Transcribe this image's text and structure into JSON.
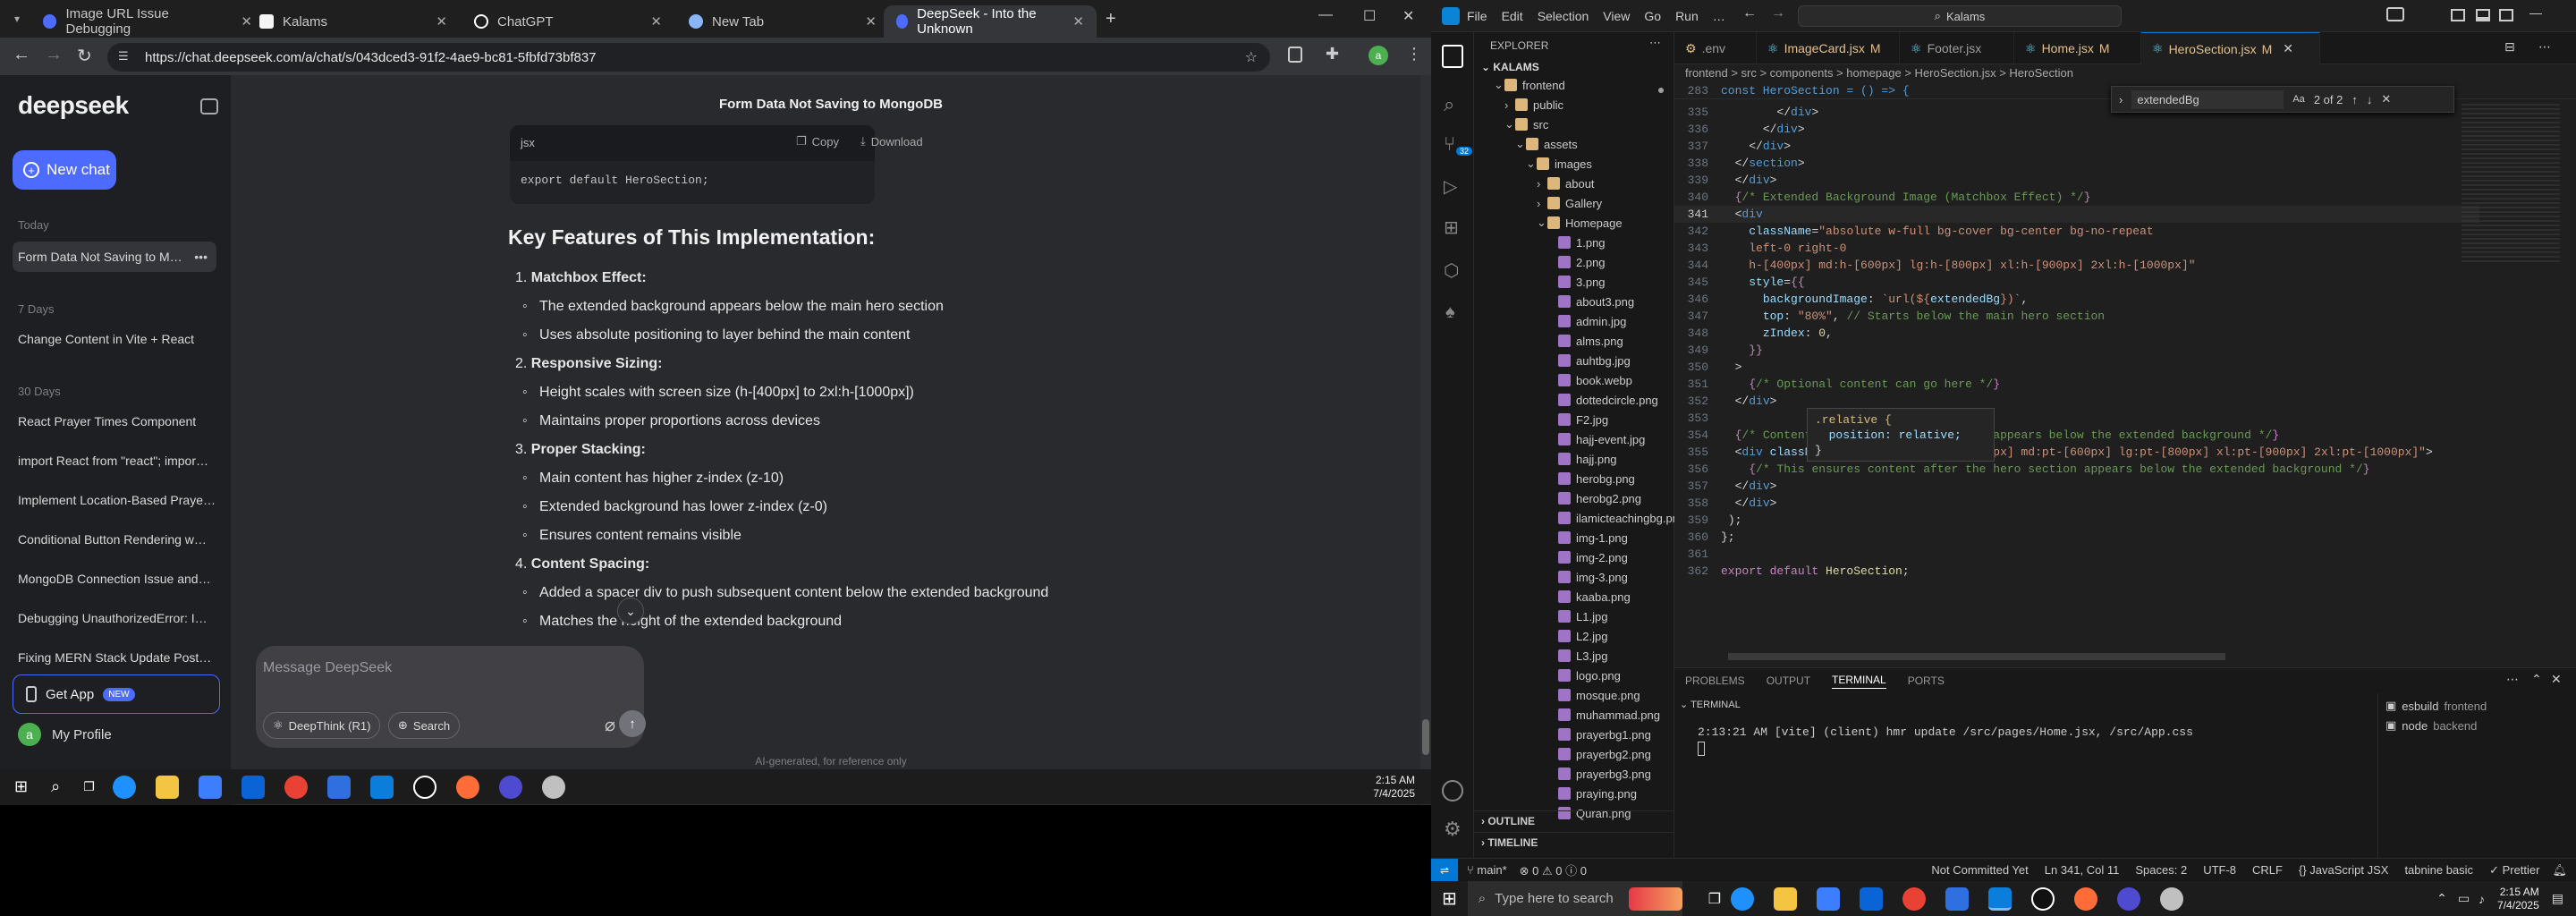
{
  "chrome": {
    "tabs": [
      {
        "title": "Image URL Issue Debugging",
        "favicon_color": "#4d6bfe"
      },
      {
        "title": "Kalams",
        "favicon_color": "#f5f5f5"
      },
      {
        "title": "ChatGPT",
        "favicon_color": "#ffffff"
      },
      {
        "title": "New Tab",
        "favicon_color": "#8ab4f8"
      },
      {
        "title": "DeepSeek - Into the Unknown",
        "favicon_color": "#4d6bfe"
      }
    ],
    "url": "https://chat.deepseek.com/a/chat/s/043dced3-91f2-4ae9-bc81-5fbfd73bf837"
  },
  "deepseek": {
    "logo": "deepseek",
    "new_chat": "New chat",
    "sections": [
      {
        "label": "Today",
        "items": [
          "Form Data Not Saving to M…"
        ]
      },
      {
        "label": "7 Days",
        "items": [
          "Change Content in Vite + React"
        ]
      },
      {
        "label": "30 Days",
        "items": [
          "React Prayer Times Component",
          "import React from \"react\"; impor…",
          "Implement Location-Based Praye…",
          "Conditional Button Rendering w…",
          "MongoDB Connection Issue and…",
          "Debugging UnauthorizedError: I…",
          "Fixing MERN Stack Update Post…"
        ]
      }
    ],
    "get_app": "Get App",
    "new_badge": "NEW",
    "profile_initial": "a",
    "profile": "My Profile",
    "chat_title": "Form Data Not Saving to MongoDB",
    "code_lang": "jsx",
    "copy": "Copy",
    "download": "Download",
    "code_line": "export default HeroSection;",
    "heading": "Key Features of This Implementation:",
    "features": [
      {
        "num": "1.",
        "title": "Matchbox Effect:",
        "bullets": [
          "The extended background appears below the main hero section",
          "Uses absolute positioning to layer behind the main content"
        ]
      },
      {
        "num": "2.",
        "title": "Responsive Sizing:",
        "bullets": [
          "Height scales with screen size (h-[400px] to 2xl:h-[1000px])",
          "Maintains proper proportions across devices"
        ]
      },
      {
        "num": "3.",
        "title": "Proper Stacking:",
        "bullets": [
          "Main content has higher z-index (z-10)",
          "Extended background has lower z-index (z-0)",
          "Ensures content remains visible"
        ]
      },
      {
        "num": "4.",
        "title": "Content Spacing:",
        "bullets": [
          "Added a spacer div to push subsequent content below the extended background",
          "Matches the height of the extended background"
        ]
      }
    ],
    "input_placeholder": "Message DeepSeek",
    "deepthink": "DeepThink (R1)",
    "search": "Search",
    "disclaimer": "AI-generated, for reference only"
  },
  "taskbar_left": {
    "time": "2:15 AM",
    "date": "7/4/2025"
  },
  "vscode": {
    "menu": [
      "File",
      "Edit",
      "Selection",
      "View",
      "Go",
      "Run",
      "…"
    ],
    "search": "Kalams",
    "explorer_title": "EXPLORER",
    "root": "KALAMS",
    "tree": [
      {
        "name": "frontend",
        "depth": 1,
        "type": "folder-open"
      },
      {
        "name": "public",
        "depth": 2,
        "type": "folder"
      },
      {
        "name": "src",
        "depth": 2,
        "type": "folder-open"
      },
      {
        "name": "assets",
        "depth": 3,
        "type": "folder-open"
      },
      {
        "name": "images",
        "depth": 4,
        "type": "folder-open"
      },
      {
        "name": "about",
        "depth": 5,
        "type": "folder"
      },
      {
        "name": "Gallery",
        "depth": 5,
        "type": "folder"
      },
      {
        "name": "Homepage",
        "depth": 5,
        "type": "folder-open"
      },
      {
        "name": "1.png",
        "depth": 6,
        "type": "img"
      },
      {
        "name": "2.png",
        "depth": 6,
        "type": "img"
      },
      {
        "name": "3.png",
        "depth": 6,
        "type": "img"
      },
      {
        "name": "about3.png",
        "depth": 6,
        "type": "img"
      },
      {
        "name": "admin.jpg",
        "depth": 6,
        "type": "img"
      },
      {
        "name": "alms.png",
        "depth": 6,
        "type": "img"
      },
      {
        "name": "auhtbg.jpg",
        "depth": 6,
        "type": "img"
      },
      {
        "name": "book.webp",
        "depth": 6,
        "type": "img"
      },
      {
        "name": "dottedcircle.png",
        "depth": 6,
        "type": "img"
      },
      {
        "name": "F2.jpg",
        "depth": 6,
        "type": "img"
      },
      {
        "name": "hajj-event.jpg",
        "depth": 6,
        "type": "img"
      },
      {
        "name": "hajj.png",
        "depth": 6,
        "type": "img"
      },
      {
        "name": "herobg.png",
        "depth": 6,
        "type": "img"
      },
      {
        "name": "herobg2.png",
        "depth": 6,
        "type": "img"
      },
      {
        "name": "ilamicteachingbg.png",
        "depth": 6,
        "type": "img"
      },
      {
        "name": "img-1.png",
        "depth": 6,
        "type": "img"
      },
      {
        "name": "img-2.png",
        "depth": 6,
        "type": "img"
      },
      {
        "name": "img-3.png",
        "depth": 6,
        "type": "img"
      },
      {
        "name": "kaaba.png",
        "depth": 6,
        "type": "img"
      },
      {
        "name": "L1.jpg",
        "depth": 6,
        "type": "img"
      },
      {
        "name": "L2.jpg",
        "depth": 6,
        "type": "img"
      },
      {
        "name": "L3.jpg",
        "depth": 6,
        "type": "img"
      },
      {
        "name": "logo.png",
        "depth": 6,
        "type": "img"
      },
      {
        "name": "mosque.png",
        "depth": 6,
        "type": "img"
      },
      {
        "name": "muhammad.png",
        "depth": 6,
        "type": "img"
      },
      {
        "name": "prayerbg1.png",
        "depth": 6,
        "type": "img"
      },
      {
        "name": "prayerbg2.png",
        "depth": 6,
        "type": "img"
      },
      {
        "name": "prayerbg3.png",
        "depth": 6,
        "type": "img"
      },
      {
        "name": "praying.png",
        "depth": 6,
        "type": "img"
      },
      {
        "name": "Quran.png",
        "depth": 6,
        "type": "img"
      }
    ],
    "outline": "OUTLINE",
    "timeline": "TIMELINE",
    "tabs": [
      {
        "name": ".env",
        "status": ""
      },
      {
        "name": "ImageCard.jsx",
        "status": "M"
      },
      {
        "name": "Footer.jsx",
        "status": ""
      },
      {
        "name": "Home.jsx",
        "status": "M"
      },
      {
        "name": "HeroSection.jsx",
        "status": "M"
      }
    ],
    "breadcrumb": "frontend > src > components > homepage > HeroSection.jsx > HeroSection",
    "sticky_line": {
      "num": "283",
      "text": "const HeroSection = () => {"
    },
    "find_query": "extendedBg",
    "find_count": "2 of 2",
    "code": [
      {
        "n": "335",
        "html": "        <span class='w'>&lt;/</span><span class='k'>div</span><span class='w'>&gt;</span>"
      },
      {
        "n": "336",
        "html": "      <span class='w'>&lt;/</span><span class='k'>div</span><span class='w'>&gt;</span>"
      },
      {
        "n": "337",
        "html": "    <span class='w'>&lt;/</span><span class='k'>div</span><span class='w'>&gt;</span>"
      },
      {
        "n": "338",
        "html": "  <span class='w'>&lt;/</span><span class='k'>section</span><span class='w'>&gt;</span>"
      },
      {
        "n": "339",
        "html": "  <span class='w'>&lt;/</span><span class='k'>div</span><span class='w'>&gt;</span>"
      },
      {
        "n": "340",
        "html": "  <span class='p'>{</span><span class='c'>/* Extended Background Image (Matchbox Effect) */</span><span class='p'>}</span>"
      },
      {
        "n": "341",
        "html": "  <span class='w'>&lt;</span><span class='k'>div</span>"
      },
      {
        "n": "342",
        "html": "    <span class='a'>className</span><span class='w'>=</span><span class='s'>\"absolute w-full bg-cover bg-center bg-no-repeat</span>"
      },
      {
        "n": "343",
        "html": "    <span class='s'>left-0 right-0</span>"
      },
      {
        "n": "344",
        "html": "    <span class='s'>h-[400px] md:h-[600px] lg:h-[800px] xl:h-[900px] 2xl:h-[1000px]\"</span>"
      },
      {
        "n": "345",
        "html": "    <span class='a'>style</span><span class='w'>=</span><span class='p'>{{</span>"
      },
      {
        "n": "346",
        "html": "      <span class='a'>backgroundImage</span><span class='w'>: </span><span class='s'>`url(${</span><span class='a'>extendedBg</span><span class='s'>})`</span><span class='w'>,</span>"
      },
      {
        "n": "347",
        "html": "      <span class='a'>top</span><span class='w'>: </span><span class='s'>\"80%\"</span><span class='w'>, </span><span class='c'>// Starts below the main hero section</span>"
      },
      {
        "n": "348",
        "html": "      <span class='a'>zIndex</span><span class='w'>: </span><span class='y'>0</span><span class='w'>,</span>"
      },
      {
        "n": "349",
        "html": "    <span class='p'>}}</span>"
      },
      {
        "n": "350",
        "html": "  <span class='w'>&gt;</span>"
      },
      {
        "n": "351",
        "html": "    <span class='p'>{</span><span class='c'>/* Optional content can go here */</span><span class='p'>}</span>"
      },
      {
        "n": "352",
        "html": "  <span class='w'>&lt;/</span><span class='k'>div</span><span class='w'>&gt;</span>"
      },
      {
        "n": "353",
        "html": ""
      },
      {
        "n": "354",
        "html": "  <span class='p'>{</span><span class='c'>/* Content spacer - ensures content appears below the extended background */</span><span class='p'>}</span>"
      },
      {
        "n": "355",
        "html": "  <span class='w'>&lt;</span><span class='k'>div</span> <span class='a'>className</span><span class='w'>=</span><span class='s'>\"relative z-20 pt-[400px] md:pt-[600px] lg:pt-[800px] xl:pt-[900px] 2xl:pt-[1000px]\"</span><span class='w'>&gt;</span>"
      },
      {
        "n": "356",
        "html": "    <span class='p'>{</span><span class='c'>/* This ensures content after the hero section appears below the extended background */</span><span class='p'>}</span>"
      },
      {
        "n": "357",
        "html": "  <span class='w'>&lt;/</span><span class='k'>div</span><span class='w'>&gt;</span>"
      },
      {
        "n": "358",
        "html": "  <span class='w'>&lt;/</span><span class='k'>div</span><span class='w'>&gt;</span>"
      },
      {
        "n": "359",
        "html": " <span class='w'>);</span>"
      },
      {
        "n": "360",
        "html": "<span class='w'>};</span>"
      },
      {
        "n": "361",
        "html": ""
      },
      {
        "n": "362",
        "html": "<span class='p'>export default</span> <span class='y'>HeroSection</span><span class='w'>;</span>"
      }
    ],
    "hover": [
      ".relative {",
      "  position: relative;",
      "}"
    ],
    "panel_tabs": [
      "PROBLEMS",
      "OUTPUT",
      "TERMINAL",
      "PORTS"
    ],
    "terminal_label": "TERMINAL",
    "terminal_line": "2:13:21 AM [vite] (client) hmr update /src/pages/Home.jsx, /src/App.css",
    "terminal_sessions": [
      {
        "name": "esbuild",
        "cwd": "frontend"
      },
      {
        "name": "node",
        "cwd": "backend"
      }
    ],
    "status": {
      "branch": "main*",
      "problems": "⊗ 0 ⚠ 0  ⓘ 0",
      "commit": "Not Committed Yet",
      "cursor": "Ln 341, Col 11",
      "spaces": "Spaces: 2",
      "encoding": "UTF-8",
      "eol": "CRLF",
      "language": "{} JavaScript JSX",
      "tabnine": "tabnine basic",
      "prettier": "Prettier"
    }
  },
  "taskbar_right": {
    "search_placeholder": "Type here to search",
    "time": "2:15 AM",
    "date": "7/4/2025"
  },
  "colors": {
    "accent": "#4d6bfe",
    "vscode_blue": "#0078d4"
  }
}
